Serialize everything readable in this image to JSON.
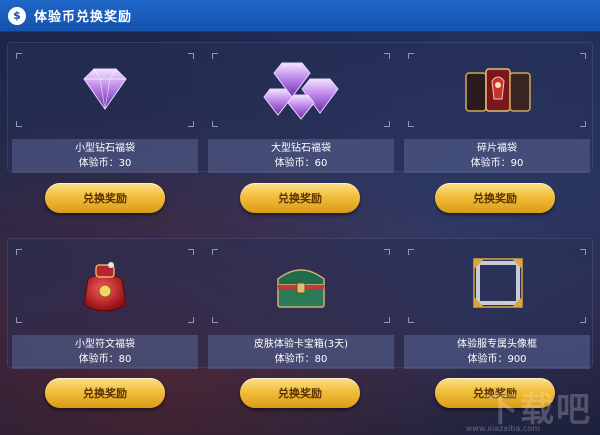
{
  "header": {
    "title": "体验币兑换奖励",
    "icon": "money-bag-icon"
  },
  "rewards": [
    {
      "name": "小型钻石福袋",
      "cost": "体验币：30",
      "icon": "small-diamond-icon",
      "button": "兑换奖励"
    },
    {
      "name": "大型钻石福袋",
      "cost": "体验币：60",
      "icon": "large-diamond-icon",
      "button": "兑换奖励"
    },
    {
      "name": "碎片福袋",
      "cost": "体验币：90",
      "icon": "fragment-bag-icon",
      "button": "兑换奖励"
    },
    {
      "name": "小型符文福袋",
      "cost": "体验币：80",
      "icon": "rune-bag-icon",
      "button": "兑换奖励"
    },
    {
      "name": "皮肤体验卡宝箱(3天)",
      "cost": "体验币：80",
      "icon": "treasure-chest-icon",
      "button": "兑换奖励"
    },
    {
      "name": "体验服专属头像框",
      "cost": "体验币：900",
      "icon": "avatar-frame-icon",
      "button": "兑换奖励"
    }
  ],
  "watermark": {
    "main": "下载吧",
    "sub": "www.xiazaiba.com"
  },
  "colors": {
    "header": "#1553ad",
    "button": "#f2be3a",
    "button_text": "#5a3300"
  }
}
